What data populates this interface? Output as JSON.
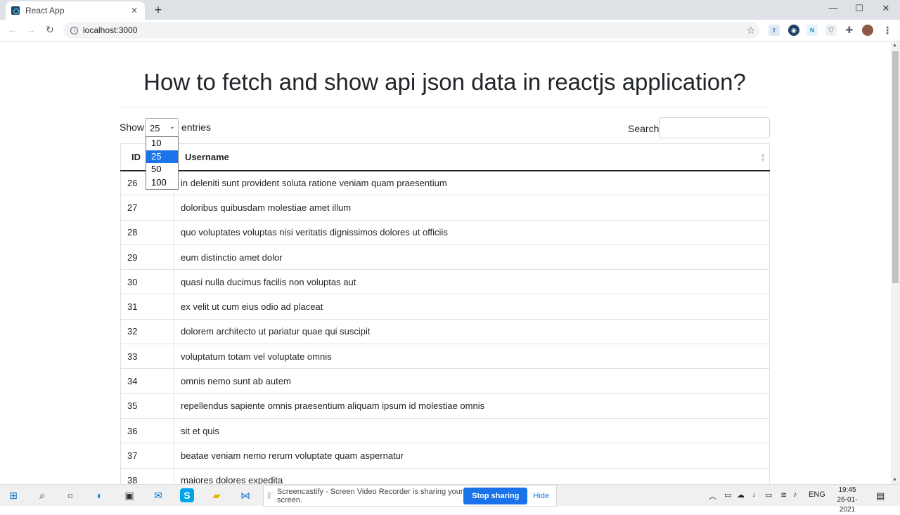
{
  "browser": {
    "tab_title": "React App",
    "url": "localhost:3000",
    "new_tab": "+",
    "minimize": "—",
    "maximize": "☐",
    "close": "✕"
  },
  "page": {
    "title": "How to fetch and show api json data in reactjs application?",
    "show_label": "Show",
    "entries_label": "entries",
    "selected_length": "25",
    "length_options": [
      "10",
      "25",
      "50",
      "100"
    ],
    "search_label": "Search:",
    "search_value": ""
  },
  "table": {
    "headers": [
      "ID",
      "Username"
    ],
    "rows": [
      {
        "id": "26",
        "username": "in deleniti sunt provident soluta ratione veniam quam praesentium"
      },
      {
        "id": "27",
        "username": "doloribus quibusdam molestiae amet illum"
      },
      {
        "id": "28",
        "username": "quo voluptates voluptas nisi veritatis dignissimos dolores ut officiis"
      },
      {
        "id": "29",
        "username": "eum distinctio amet dolor"
      },
      {
        "id": "30",
        "username": "quasi nulla ducimus facilis non voluptas aut"
      },
      {
        "id": "31",
        "username": "ex velit ut cum eius odio ad placeat"
      },
      {
        "id": "32",
        "username": "dolorem architecto ut pariatur quae qui suscipit"
      },
      {
        "id": "33",
        "username": "voluptatum totam vel voluptate omnis"
      },
      {
        "id": "34",
        "username": "omnis nemo sunt ab autem"
      },
      {
        "id": "35",
        "username": "repellendus sapiente omnis praesentium aliquam ipsum id molestiae omnis"
      },
      {
        "id": "36",
        "username": "sit et quis"
      },
      {
        "id": "37",
        "username": "beatae veniam nemo rerum voluptate quam aspernatur"
      },
      {
        "id": "38",
        "username": "maiores dolores expedita"
      }
    ]
  },
  "sharebar": {
    "message": "Screencastify - Screen Video Recorder is sharing your screen.",
    "stop_label": "Stop sharing",
    "hide_label": "Hide"
  },
  "taskbar": {
    "language": "ENG",
    "time": "19:45",
    "date": "26-01-2021"
  },
  "colors": {
    "selected_option": "#1a73e8",
    "stop_button": "#1a73e8"
  }
}
